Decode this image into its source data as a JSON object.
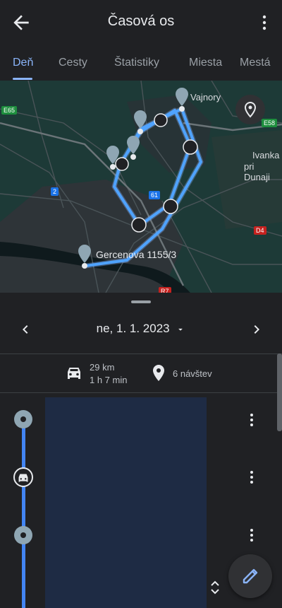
{
  "header": {
    "title": "Časová os",
    "back_icon": "arrow-back-icon",
    "more_icon": "more-vertical-icon"
  },
  "tabs": [
    {
      "label": "Deň",
      "active": true
    },
    {
      "label": "Cesty",
      "active": false
    },
    {
      "label": "Štatistiky",
      "active": false
    },
    {
      "label": "Miesta",
      "active": false
    },
    {
      "label": "Mestá",
      "active": false
    }
  ],
  "map": {
    "labels": {
      "vajnory": "Vajnory",
      "ivanka_line1": "Ivanka",
      "ivanka_line2": "pri Dunaji",
      "gercenova": "Gercenova 1155/3"
    },
    "roads": {
      "e65": "E65",
      "e58": "E58",
      "r2": "2",
      "r61": "61",
      "d4": "D4",
      "r7": "R7"
    },
    "route_color": "#4285f4"
  },
  "datebar": {
    "date": "ne, 1. 1. 2023"
  },
  "summary": {
    "distance": "29 km",
    "duration": "1 h 7 min",
    "visits": "6 návštev"
  },
  "colors": {
    "background": "#202124",
    "accent": "#8ab4f8",
    "timeline": "#4285f4",
    "map_bg": "#1d3a37"
  }
}
